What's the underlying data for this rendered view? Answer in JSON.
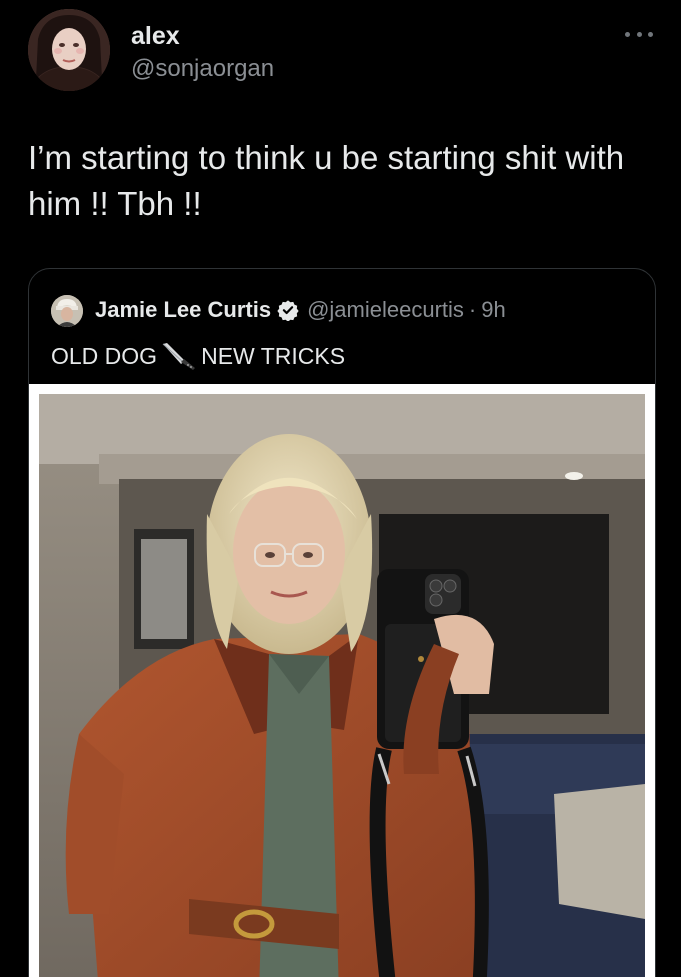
{
  "tweet": {
    "author": {
      "display_name": "alex",
      "handle": "@sonjaorgan",
      "avatar_icon": "user-avatar"
    },
    "more_icon": "more-horizontal-icon",
    "text": "I’m starting to think u be starting shit with him !! Tbh !!"
  },
  "quoted_tweet": {
    "author": {
      "display_name": "Jamie Lee Curtis",
      "handle": "@jamieleecurtis",
      "verified": true,
      "verified_icon": "verified-badge-icon",
      "avatar_icon": "user-avatar"
    },
    "separator": "·",
    "timestamp": "9h",
    "text_before": "OLD DOG",
    "emoji": "knife-icon",
    "text_after": "NEW TRICKS",
    "media": {
      "type": "photo"
    }
  },
  "colors": {
    "background": "#000000",
    "text_primary": "#e7e9ea",
    "text_secondary": "#8b8f94",
    "border": "#2f3336",
    "verified": "#e7e9ea"
  }
}
